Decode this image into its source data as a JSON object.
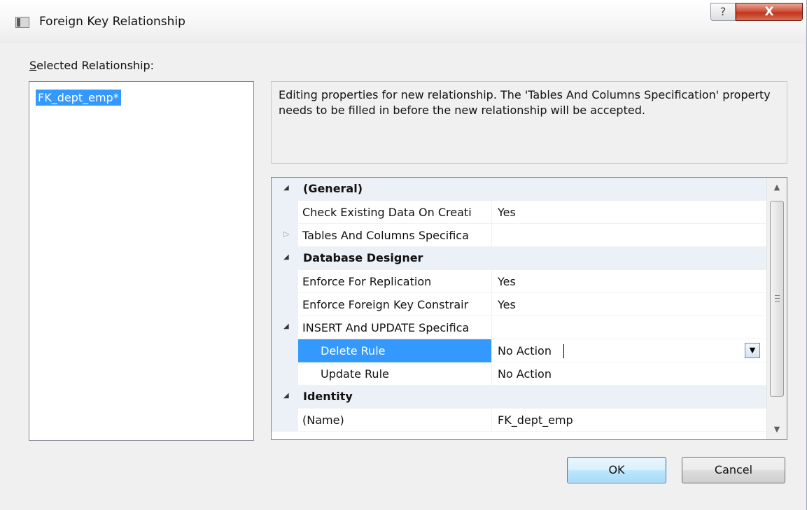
{
  "window": {
    "title": "Foreign Key Relationship",
    "help_glyph": "?",
    "close_glyph": "X"
  },
  "selected_relationship": {
    "label_accel": "S",
    "label_rest": "elected Relationship:",
    "item": "FK_dept_emp*"
  },
  "description": "Editing properties for new relationship.  The 'Tables And Columns Specification' property needs to be filled in before the new relationship will be accepted.",
  "property_grid": {
    "general": {
      "label": "(General)",
      "check_existing": {
        "name": "Check Existing Data On Creati",
        "value": "Yes"
      },
      "tables_columns": {
        "name": "Tables And Columns Specifica",
        "value": ""
      }
    },
    "database_designer": {
      "label": "Database Designer",
      "enforce_replication": {
        "name": "Enforce For Replication",
        "value": "Yes"
      },
      "enforce_fk": {
        "name": "Enforce Foreign Key Constrair",
        "value": "Yes"
      },
      "insert_update": {
        "name": "INSERT And UPDATE Specifica",
        "value": "",
        "delete_rule": {
          "name": "Delete Rule",
          "value": "No Action"
        },
        "update_rule": {
          "name": "Update Rule",
          "value": "No Action"
        }
      }
    },
    "identity": {
      "label": "Identity",
      "name_prop": {
        "name": "(Name)",
        "value": "FK_dept_emp"
      }
    }
  },
  "buttons": {
    "ok": "OK",
    "cancel": "Cancel"
  },
  "icons": {
    "expanded": "expanded-triangle-icon",
    "collapsed": "collapsed-triangle-icon",
    "dropdown": "dropdown-arrow-icon",
    "scroll_up": "scroll-up-arrow-icon",
    "scroll_down": "scroll-down-arrow-icon"
  },
  "colors": {
    "selection": "#3399ff",
    "category_background": "#ecf0f7",
    "close_button": "#c2341c"
  }
}
